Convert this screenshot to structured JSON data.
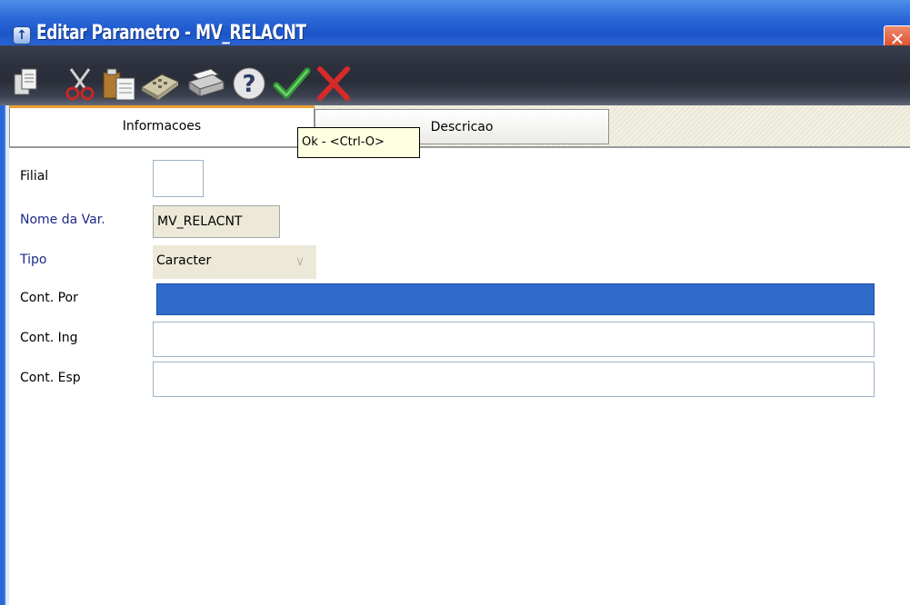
{
  "window": {
    "title": "Editar Parametro - MV_RELACNT",
    "close_label": "✕"
  },
  "toolbar": {
    "items": [
      {
        "icon": "copy-icon"
      },
      {
        "icon": "cut-icon"
      },
      {
        "icon": "paste-icon"
      },
      {
        "icon": "calculator-icon"
      },
      {
        "icon": "printer-icon"
      },
      {
        "icon": "help-icon"
      },
      {
        "icon": "ok-check-icon"
      },
      {
        "icon": "cancel-x-icon"
      }
    ],
    "tooltip": "Ok - <Ctrl-O>"
  },
  "tabs": [
    {
      "label": "Informacoes",
      "active": true
    },
    {
      "label": "Descricao",
      "active": false
    }
  ],
  "form": {
    "filial": {
      "label": "Filial",
      "value": ""
    },
    "nome_var": {
      "label": "Nome da Var.",
      "value": "MV_RELACNT"
    },
    "tipo": {
      "label": "Tipo",
      "value": "Caracter"
    },
    "cont_por": {
      "label": "Cont. Por",
      "value": ""
    },
    "cont_ing": {
      "label": "Cont. Ing",
      "value": ""
    },
    "cont_esp": {
      "label": "Cont. Esp",
      "value": ""
    }
  },
  "colors": {
    "titlebar": "#2b68d8",
    "selection": "#2f6bcb",
    "label_blue": "#1e2a8a"
  }
}
